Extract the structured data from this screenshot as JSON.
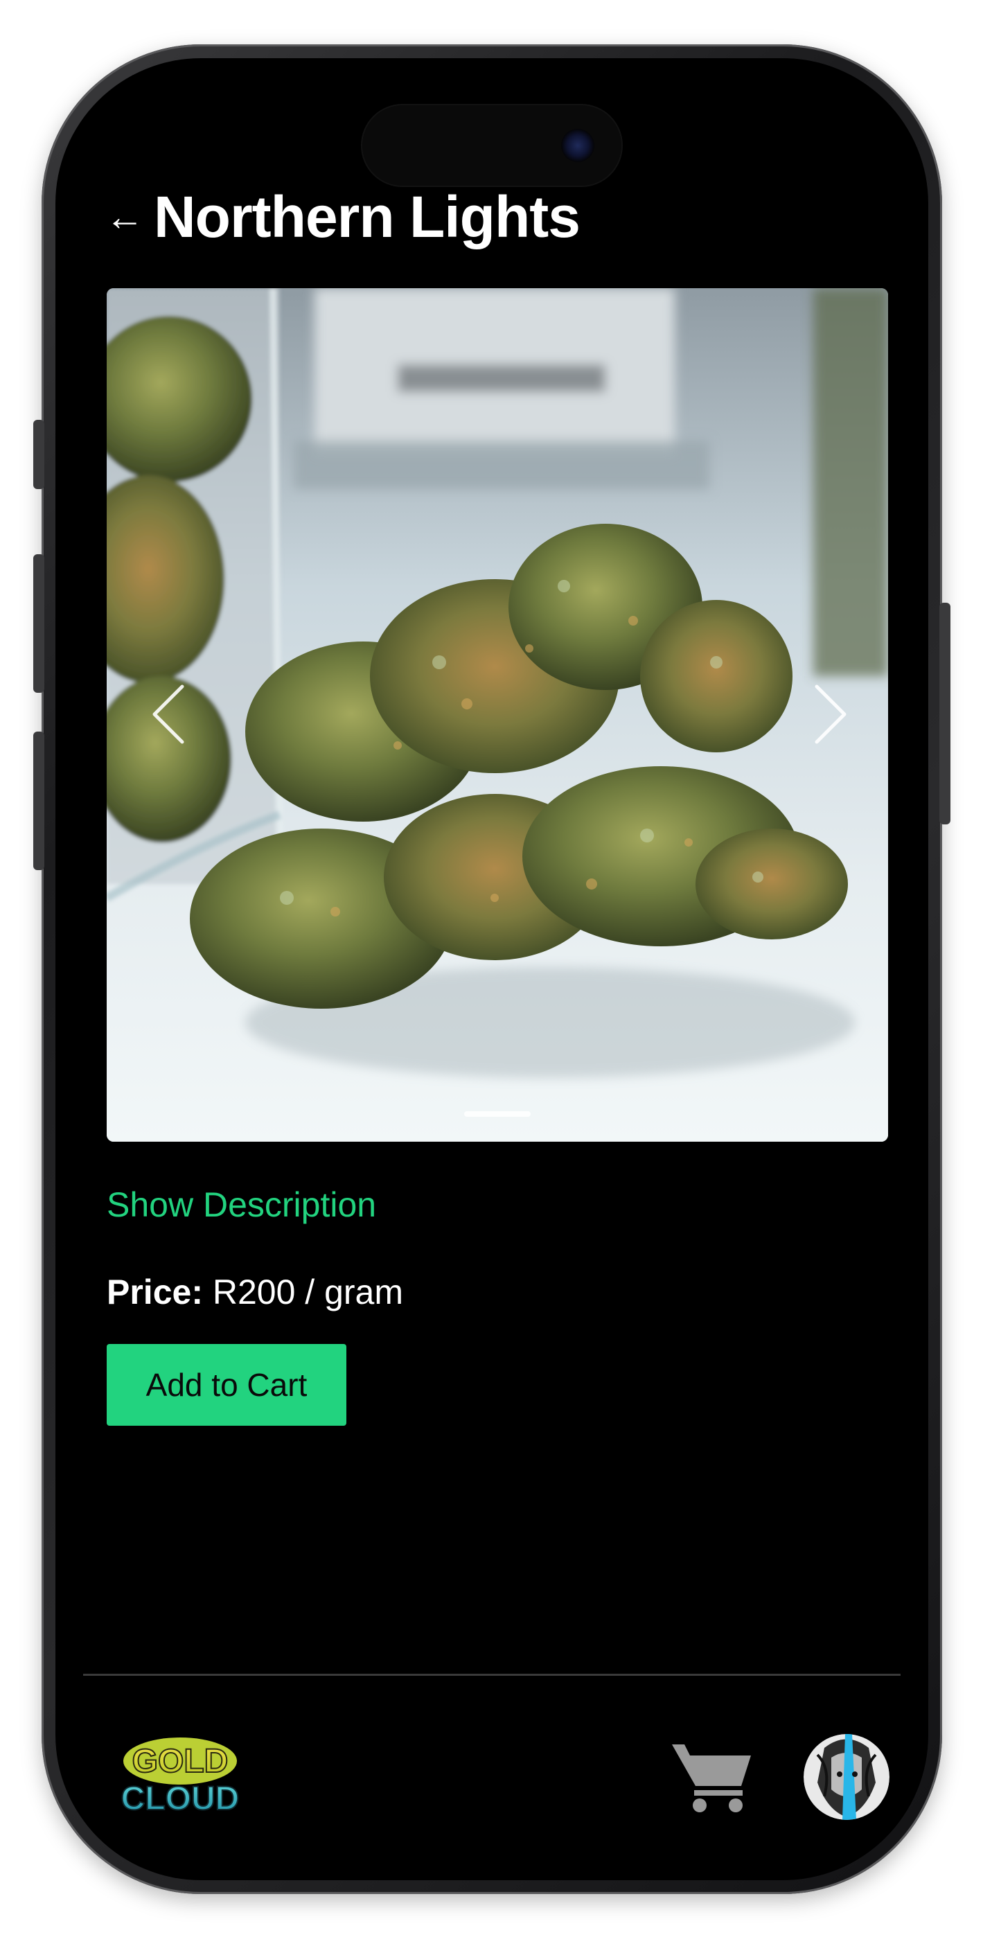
{
  "header": {
    "back_icon": "arrow-left-icon",
    "back_glyph": "←",
    "title": "Northern Lights"
  },
  "carousel": {
    "image_alt": "cannabis buds on a white surface with glass jars",
    "prev_icon": "chevron-left-icon",
    "next_icon": "chevron-right-icon",
    "active_slide": 1
  },
  "details": {
    "show_description_label": "Show Description",
    "price_label": "Price:",
    "price_value": "R200 / gram",
    "add_to_cart_label": "Add to Cart"
  },
  "bottom_bar": {
    "logo_line1": "GOLD",
    "logo_line2": "CLOUD",
    "cart_icon": "shopping-cart-icon",
    "avatar_icon": "user-avatar"
  },
  "colors": {
    "accent": "#22d37f",
    "background": "#000000",
    "text": "#ffffff",
    "icon_gray": "#9a9a9a"
  }
}
